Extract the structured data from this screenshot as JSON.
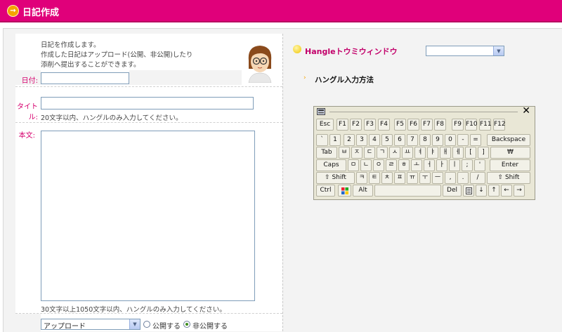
{
  "header": {
    "title": "日記作成",
    "arrow_icon": "→"
  },
  "intro": {
    "line1": "日記を作成します。",
    "line2": "作成した日記はアップロード(公開、非公開)したり",
    "line3": "添削へ提出することができます。"
  },
  "form": {
    "date_label": "日付:",
    "date_value": "",
    "title_label": "タイトル:",
    "title_value": "",
    "title_hint": "20文字以内、ハングルのみ入力してください。",
    "body_label": "本文:",
    "body_value": "",
    "body_hint": "30文字以上1050文字以内、ハングルのみ入力してください。",
    "action_select": "アップロード",
    "radio_public": "公開する",
    "radio_private": "非公開する",
    "selected_visibility": "private"
  },
  "hangle": {
    "window_title": "Hangleトウミウィンドウ",
    "window_select": "",
    "method_link": "ハングル入力方法"
  },
  "keyboard": {
    "row1": [
      "Esc",
      "F1",
      "F2",
      "F3",
      "F4",
      "F5",
      "F6",
      "F7",
      "F8",
      "F9",
      "F10",
      "F11",
      "F12"
    ],
    "row2": [
      "`",
      "1",
      "2",
      "3",
      "4",
      "5",
      "6",
      "7",
      "8",
      "9",
      "0",
      "-",
      "=",
      "Backspace"
    ],
    "row3": [
      "Tab",
      "ㅂ",
      "ㅈ",
      "ㄷ",
      "ㄱ",
      "ㅅ",
      "ㅛ",
      "ㅕ",
      "ㅑ",
      "ㅐ",
      "ㅔ",
      "[",
      "]",
      "₩"
    ],
    "row4": [
      "Caps",
      "ㅁ",
      "ㄴ",
      "ㅇ",
      "ㄹ",
      "ㅎ",
      "ㅗ",
      "ㅓ",
      "ㅏ",
      "ㅣ",
      ";",
      "'",
      "Enter"
    ],
    "row5": [
      "⇧ Shift",
      "ㅋ",
      "ㅌ",
      "ㅊ",
      "ㅍ",
      "ㅠ",
      "ㅜ",
      "ㅡ",
      ",",
      ".",
      "/",
      "⇧ Shift"
    ],
    "row6": [
      "Ctrl",
      "",
      "Alt",
      "",
      "Del",
      "",
      "↓",
      "↑",
      "←",
      "→"
    ]
  },
  "colors": {
    "accent": "#e0007a",
    "label": "#d6006e",
    "keyboard_bg": "#e9e7d6"
  }
}
